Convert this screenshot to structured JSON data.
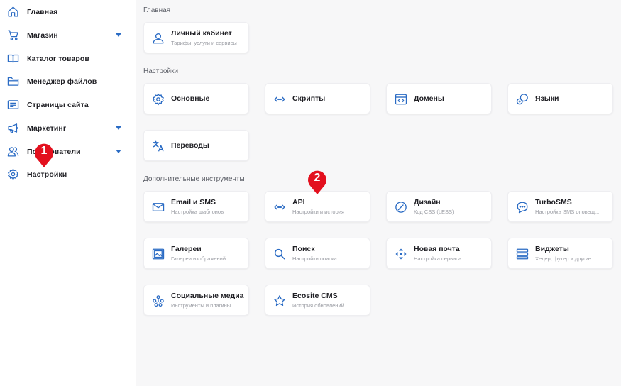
{
  "sidebar": {
    "items": [
      {
        "label": "Главная",
        "icon": "home-icon",
        "has_caret": false
      },
      {
        "label": "Магазин",
        "icon": "cart-icon",
        "has_caret": true
      },
      {
        "label": "Каталог товаров",
        "icon": "book-icon",
        "has_caret": false
      },
      {
        "label": "Менеджер файлов",
        "icon": "folder-icon",
        "has_caret": false
      },
      {
        "label": "Страницы сайта",
        "icon": "pages-icon",
        "has_caret": false
      },
      {
        "label": "Маркетинг",
        "icon": "megaphone-icon",
        "has_caret": true
      },
      {
        "label": "Пользователи",
        "icon": "users-icon",
        "has_caret": true
      },
      {
        "label": "Настройки",
        "icon": "gear-icon",
        "has_caret": false
      }
    ]
  },
  "sections": {
    "home": {
      "title": "Главная",
      "cards": [
        {
          "title": "Личный кабинет",
          "subtitle": "Тарифы, услуги и сервисы",
          "icon": "user-icon"
        }
      ]
    },
    "settings": {
      "title": "Настройки",
      "cards": [
        {
          "title": "Основные",
          "icon": "gear-icon"
        },
        {
          "title": "Скрипты",
          "icon": "code-icon"
        },
        {
          "title": "Домены",
          "icon": "browser-code-icon"
        },
        {
          "title": "Языки",
          "icon": "languages-icon"
        },
        {
          "title": "Переводы",
          "icon": "translate-icon"
        }
      ]
    },
    "tools": {
      "title": "Дополнительные инструменты",
      "cards": [
        {
          "title": "Email и SMS",
          "subtitle": "Настройка шаблонов",
          "icon": "mail-icon"
        },
        {
          "title": "API",
          "subtitle": "Настройки и история",
          "icon": "code-icon"
        },
        {
          "title": "Дизайн",
          "subtitle": "Код CSS (LESS)",
          "icon": "brush-icon"
        },
        {
          "title": "TurboSMS",
          "subtitle": "Настройка SMS оповещ...",
          "icon": "chat-icon"
        },
        {
          "title": "Галереи",
          "subtitle": "Галереи изображений",
          "icon": "gallery-icon"
        },
        {
          "title": "Поиск",
          "subtitle": "Настройки поиска",
          "icon": "search-icon"
        },
        {
          "title": "Новая почта",
          "subtitle": "Настройка сервиса",
          "icon": "nova-poshta-icon"
        },
        {
          "title": "Виджеты",
          "subtitle": "Хедер, футер и другие",
          "icon": "widgets-icon"
        },
        {
          "title": "Социальные медиа",
          "subtitle": "Инструменты и плагины",
          "icon": "social-icon"
        },
        {
          "title": "Ecosite CMS",
          "subtitle": "История обновлений",
          "icon": "star-icon"
        }
      ]
    }
  },
  "markers": [
    {
      "number": "1",
      "target": "Настройки"
    },
    {
      "number": "2",
      "target": "API"
    }
  ],
  "colors": {
    "accent": "#2a6bc4",
    "marker": "#e3101e",
    "background": "#f7f7f8"
  }
}
